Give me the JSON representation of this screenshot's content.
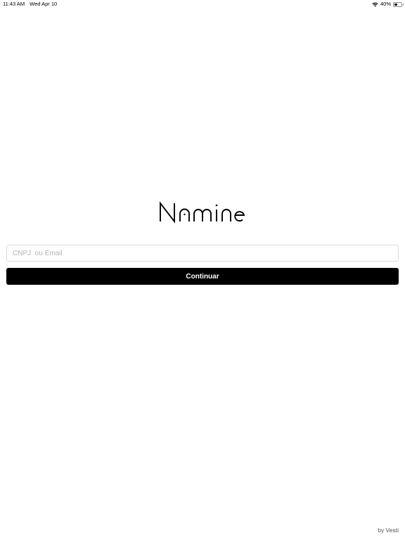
{
  "status_bar": {
    "time": "11:43 AM",
    "date": "Wed Apr 10",
    "battery_percent": "40%",
    "battery_level": 0.4,
    "wifi_icon": "wifi-icon",
    "battery_icon": "battery-icon"
  },
  "logo": {
    "text": "Namine"
  },
  "login": {
    "identifier_value": "",
    "identifier_placeholder": "CNPJ  ou Email",
    "continue_label": "Continuar"
  },
  "footer": {
    "credit": "by Vesti"
  }
}
